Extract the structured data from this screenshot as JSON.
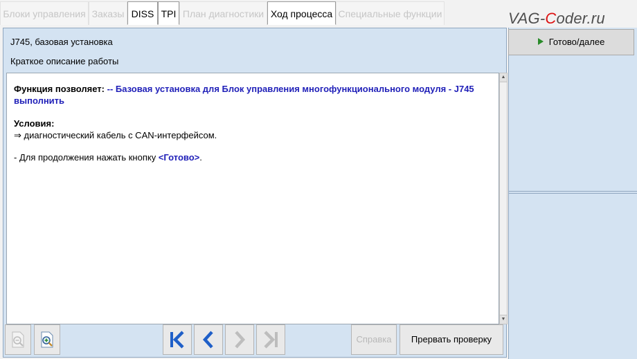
{
  "tabs": [
    {
      "label": "Блоки управления",
      "active": false
    },
    {
      "label": "Заказы",
      "active": false
    },
    {
      "label": "DISS",
      "active": true
    },
    {
      "label": "TPI",
      "active": true
    },
    {
      "label": "План диагностики",
      "active": false
    },
    {
      "label": "Ход процесса",
      "active": true
    },
    {
      "label": "Специальные функции",
      "active": false
    }
  ],
  "watermark": {
    "part1": "VAG-",
    "part2": "C",
    "part3": "oder.ru"
  },
  "header": {
    "title": "J745, базовая установка",
    "subtitle": "Краткое описание работы"
  },
  "content": {
    "function_label": "Функция позволяет:",
    "function_text": "-- Базовая установка для Блок управления многофункционального модуля - J745 выполнить",
    "conditions_label": "Условия:",
    "condition_arrow": "⇒",
    "condition_text": "диагностический кабель с CAN-интерфейсом.",
    "instruction_prefix": "- Для продолжения нажать кнопку",
    "instruction_button": "<Готово>",
    "instruction_suffix": "."
  },
  "toolbar": {
    "help_label": "Справка",
    "abort_label": "Прервать проверку"
  },
  "right_panel": {
    "next_label": "Готово/далее"
  },
  "colors": {
    "accent_blue": "#1f1fb8",
    "panel_bg": "#d4e3f2",
    "play_green": "#2a8b2a",
    "nav_blue": "#1f5fc8"
  }
}
